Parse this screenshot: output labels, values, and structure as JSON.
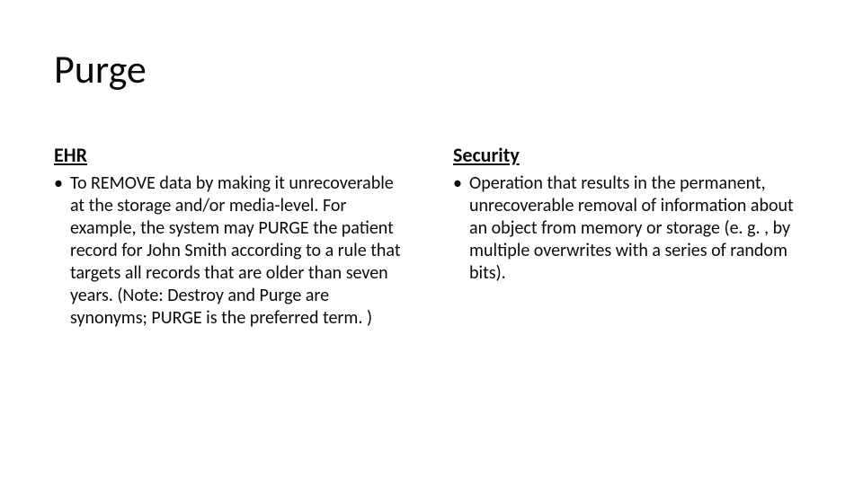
{
  "title": "Purge",
  "left": {
    "heading": "EHR",
    "bullet": "To REMOVE data by making it unrecoverable at the storage and/or media-level. For example, the system may PURGE the patient record for John Smith according to a rule that targets all records that are older than seven years. (Note: Destroy and Purge are synonyms; PURGE is the preferred term. )"
  },
  "right": {
    "heading": "Security",
    "bullet": "Operation that results in the permanent, unrecoverable removal of information about an object from memory or storage (e. g. , by multiple overwrites with a series of random bits)."
  }
}
